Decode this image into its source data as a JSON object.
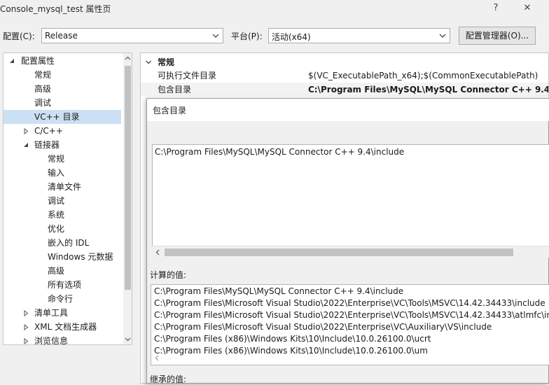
{
  "window": {
    "title": "Console_mysql_test 属性页",
    "help_glyph": "?",
    "close_glyph": "✕"
  },
  "config_bar": {
    "config_label": "配置(C):",
    "config_value": "Release",
    "platform_label": "平台(P):",
    "platform_value": "活动(x64)",
    "manager_button": "配置管理器(O)..."
  },
  "tree": {
    "items": [
      {
        "label": "配置属性",
        "level": 0,
        "expander": "expanded"
      },
      {
        "label": "常规",
        "level": 1
      },
      {
        "label": "高级",
        "level": 1
      },
      {
        "label": "调试",
        "level": 1
      },
      {
        "label": "VC++ 目录",
        "level": 1,
        "selected": true
      },
      {
        "label": "C/C++",
        "level": 1,
        "expander": "collapsed"
      },
      {
        "label": "链接器",
        "level": 1,
        "expander": "expanded"
      },
      {
        "label": "常规",
        "level": 2
      },
      {
        "label": "输入",
        "level": 2
      },
      {
        "label": "清单文件",
        "level": 2
      },
      {
        "label": "调试",
        "level": 2
      },
      {
        "label": "系统",
        "level": 2
      },
      {
        "label": "优化",
        "level": 2
      },
      {
        "label": "嵌入的 IDL",
        "level": 2
      },
      {
        "label": "Windows 元数据",
        "level": 2
      },
      {
        "label": "高级",
        "level": 2
      },
      {
        "label": "所有选项",
        "level": 2
      },
      {
        "label": "命令行",
        "level": 2
      },
      {
        "label": "清单工具",
        "level": 1,
        "expander": "collapsed"
      },
      {
        "label": "XML 文档生成器",
        "level": 1,
        "expander": "collapsed"
      },
      {
        "label": "浏览信息",
        "level": 1,
        "expander": "collapsed"
      }
    ]
  },
  "grid": {
    "section": "常规",
    "rows": [
      {
        "name": "可执行文件目录",
        "value": "$(VC_ExecutablePath_x64);$(CommonExecutablePath)",
        "bold": false
      },
      {
        "name": "包含目录",
        "value": "C:\\Program Files\\MySQL\\MySQL Connector C++ 9.4\\",
        "bold": true
      }
    ]
  },
  "dialog": {
    "title": "包含目录",
    "entry": "C:\\Program Files\\MySQL\\MySQL Connector C++ 9.4\\include",
    "computed_label": "计算的值:",
    "computed_values": [
      "C:\\Program Files\\MySQL\\MySQL Connector C++ 9.4\\include",
      "C:\\Program Files\\Microsoft Visual Studio\\2022\\Enterprise\\VC\\Tools\\MSVC\\14.42.34433\\include",
      "C:\\Program Files\\Microsoft Visual Studio\\2022\\Enterprise\\VC\\Tools\\MSVC\\14.42.34433\\atlmfc\\include",
      "C:\\Program Files\\Microsoft Visual Studio\\2022\\Enterprise\\VC\\Auxiliary\\VS\\include",
      "C:\\Program Files (x86)\\Windows Kits\\10\\Include\\10.0.26100.0\\ucrt",
      "C:\\Program Files (x86)\\Windows Kits\\10\\Include\\10.0.26100.0\\um"
    ],
    "inherited_label": "继承的值:"
  }
}
